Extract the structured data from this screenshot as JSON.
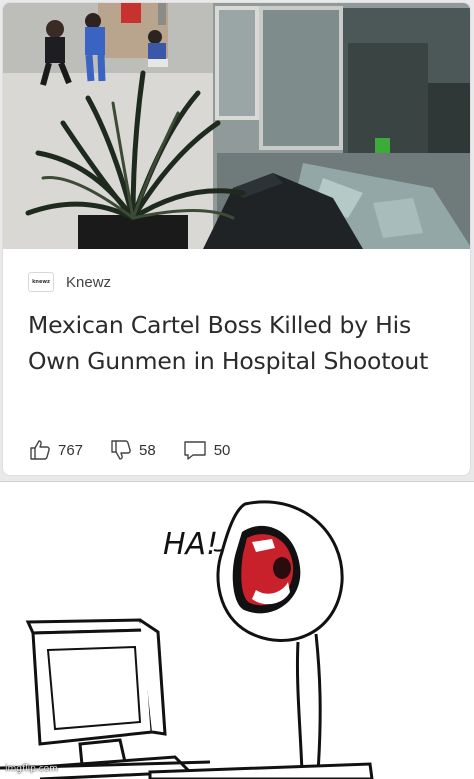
{
  "article": {
    "source_logo_text": "knewz",
    "source_name": "Knewz",
    "headline": "Mexican Cartel Boss Killed by His Own Gunmen in Hospital Shootout",
    "reactions": {
      "likes": "767",
      "dislikes": "58",
      "comments": "50"
    }
  },
  "comic": {
    "exclamation": "HA!",
    "watermark": "imgflip.com"
  },
  "icons": {
    "like": "thumbs-up-icon",
    "dislike": "thumbs-down-icon",
    "comments": "comment-bubble-icon"
  }
}
